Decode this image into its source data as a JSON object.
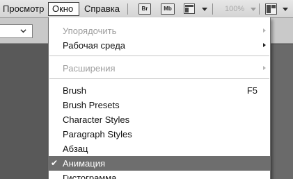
{
  "menubar": {
    "items": [
      "Просмотр",
      "Окно",
      "Справка"
    ],
    "bridge_label": "Br",
    "mini_bridge_label": "Mb",
    "zoom": "100%"
  },
  "menu": {
    "top_items": [
      {
        "label": "Упорядочить",
        "disabled": true,
        "submenu": true
      },
      {
        "label": "Рабочая среда",
        "disabled": false,
        "submenu": true
      }
    ],
    "extensions": {
      "label": "Расширения",
      "disabled": true,
      "submenu": true
    },
    "panels": [
      {
        "label": "Brush",
        "shortcut": "F5"
      },
      {
        "label": "Brush Presets",
        "shortcut": ""
      },
      {
        "label": "Character Styles",
        "shortcut": ""
      },
      {
        "label": "Paragraph Styles",
        "shortcut": ""
      },
      {
        "label": "Абзац",
        "shortcut": ""
      },
      {
        "label": "Анимация",
        "shortcut": "",
        "checked": true,
        "highlighted": true
      },
      {
        "label": "Гистограмма",
        "shortcut": ""
      }
    ]
  },
  "colors": {
    "highlight": "#6e6e6e",
    "workspace": "#595959",
    "disabled_text": "#9e9e9e"
  }
}
